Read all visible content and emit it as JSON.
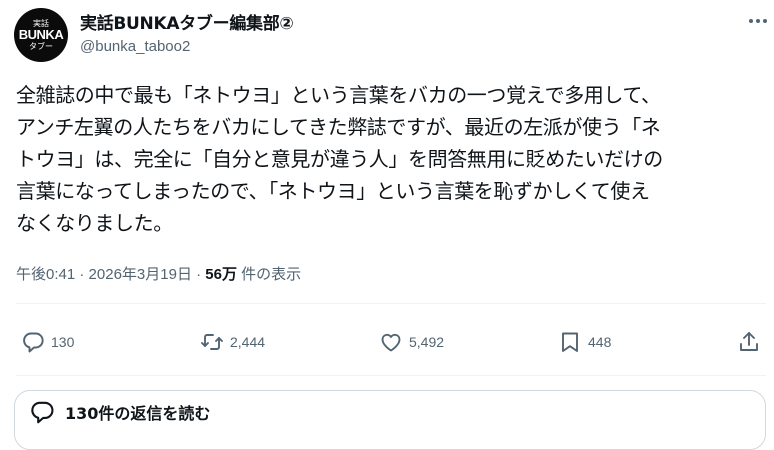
{
  "author": {
    "avatar_top": "実話",
    "avatar_main": "BUNKA",
    "avatar_bottom": "タブー",
    "display_name": "実話BUNKAタブー編集部②",
    "handle": "@bunka_taboo2"
  },
  "post": {
    "lines": [
      "全雑誌の中で最も「ネトウヨ」という言葉をバカの一つ覚えで多用して、",
      "アンチ左翼の人たちをバカにしてきた弊誌ですが、最近の左派が使う「ネ",
      "トウヨ」は、完全に「自分と意見が違う人」を問答無用に貶めたいだけの",
      "言葉になってしまったので、「ネトウヨ」という言葉を恥ずかしくて使え",
      "なくなりました。"
    ],
    "time": "午後0:41",
    "separator": "·",
    "date": "2026年3月19日",
    "views_count": "56万",
    "views_label": "件の表示"
  },
  "actions": {
    "reply_count": "130",
    "repost_count": "2,444",
    "like_count": "5,492",
    "bookmark_count": "448"
  },
  "replies_link": {
    "label": "130件の返信を読む"
  },
  "colors": {
    "text": "#0f1419",
    "secondary": "#536471",
    "border": "#cfd9de"
  },
  "icons": [
    "more-icon",
    "reply-icon",
    "repost-icon",
    "like-icon",
    "bookmark-icon",
    "share-icon",
    "speech-bubble-icon"
  ]
}
